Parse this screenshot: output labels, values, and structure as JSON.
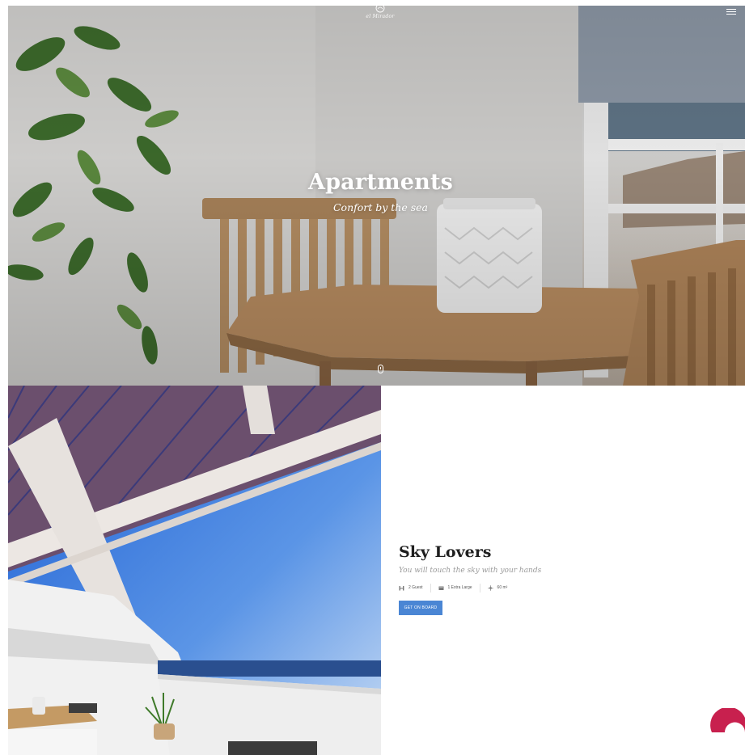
{
  "header": {
    "logo_text": "el Mirador",
    "menu_icon": "hamburger-menu-icon"
  },
  "hero": {
    "title": "Apartments",
    "subtitle": "Confort by the sea",
    "scroll_icon": "mouse-scroll-icon"
  },
  "room": {
    "title": "Sky Lovers",
    "subtitle": "You will touch the sky with your hands",
    "features": [
      {
        "icon": "guests-icon",
        "label": "2 Guest"
      },
      {
        "icon": "bed-icon",
        "label": "1 Extra Large"
      },
      {
        "icon": "area-icon",
        "label": "60 m²"
      }
    ],
    "cta_label": "GET ON BOARD"
  },
  "colors": {
    "accent": "#4a86d4",
    "decor": "#c8204e"
  }
}
